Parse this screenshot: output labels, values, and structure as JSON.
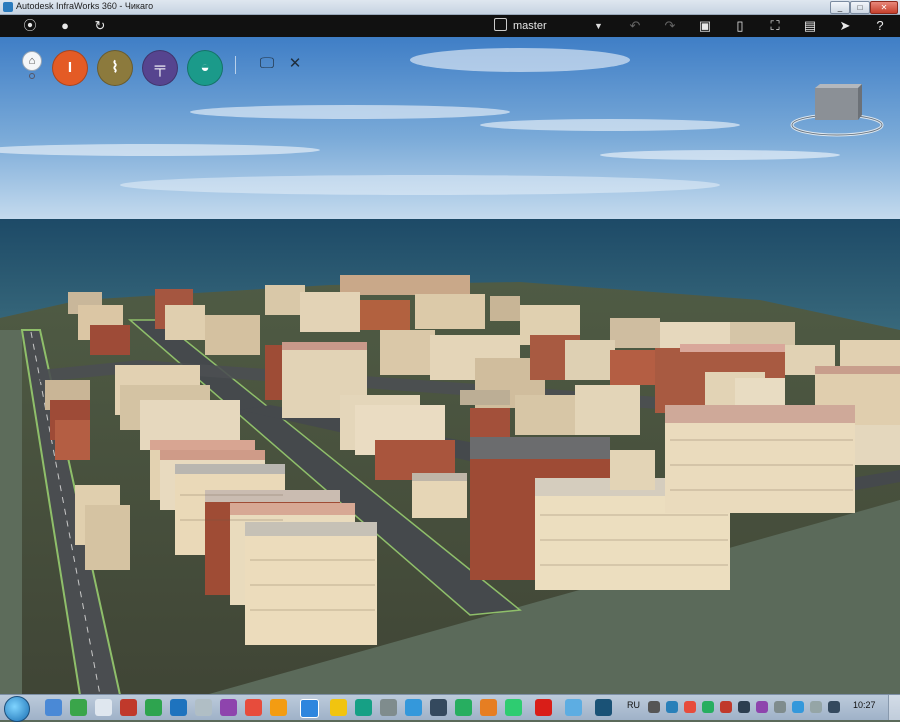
{
  "window": {
    "title": "Autodesk InfraWorks 360 - Чикаго",
    "controls": [
      "minimize-icon",
      "maximize-icon",
      "close-icon"
    ]
  },
  "toolbar": {
    "left_icons": [
      "account-icon",
      "record-icon",
      "sync-icon"
    ],
    "branch_label": "master",
    "right_icons": [
      "undo-icon",
      "redo-icon",
      "screenshot-icon",
      "panel-icon",
      "fullscreen-icon",
      "present-icon",
      "cursor-icon",
      "help-icon"
    ],
    "help_label": "?"
  },
  "tools": {
    "home_icon": "home-icon",
    "buttons": [
      {
        "name": "create-and-manage-model-button",
        "icon": "building-icon",
        "color": "#e45b25"
      },
      {
        "name": "design-roads-button",
        "icon": "road-icon",
        "color": "#8c7a3d"
      },
      {
        "name": "bridges-button",
        "icon": "bridge-icon",
        "color": "#56448f"
      },
      {
        "name": "drainage-button",
        "icon": "drainage-icon",
        "color": "#1b9a8a"
      }
    ],
    "settings_icons": [
      "presentation-icon",
      "settings-icon"
    ]
  },
  "taskbar": {
    "language": "RU",
    "clock": "10:27"
  },
  "colors": {
    "sky_top": "#3f7ec6",
    "sky_bottom": "#b9d3ea",
    "sea": "#1f4c68",
    "ground": "#6b7a66",
    "toolbar": "#111111"
  }
}
